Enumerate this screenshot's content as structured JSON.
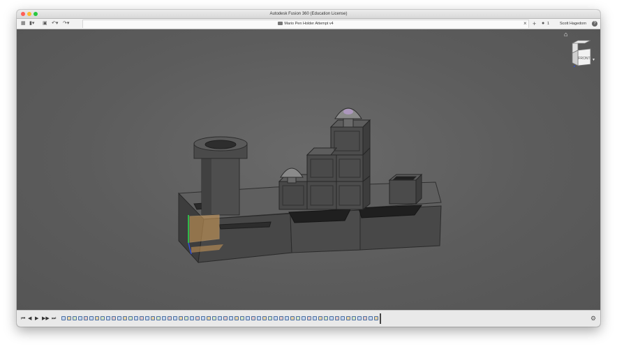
{
  "window": {
    "title": "Autodesk Fusion 360 (Education License)",
    "traffic_lights": {
      "close": "#fe5f57",
      "minimize": "#febc2e",
      "maximize": "#28c840"
    }
  },
  "toolbar": {
    "icons": [
      "grid-icon",
      "file-icon",
      "save-icon",
      "undo-icon",
      "redo-icon"
    ],
    "document_tab": {
      "title": "Mario Pen Holder Attempt v4",
      "close_glyph": "×"
    },
    "new_tab_glyph": "+",
    "job_count": "1",
    "user_name": "Scott Hagedorn",
    "help_glyph": "?"
  },
  "viewcube": {
    "face_label": "FRONT"
  },
  "model": {
    "body_color": "#4a4a4a",
    "highlight_color": "#d9a25a",
    "axis_colors": {
      "x": "#d93030",
      "y": "#2fb84a",
      "z": "#2f4fd9"
    }
  },
  "timeline": {
    "controls": [
      "⏮",
      "◀",
      "▶",
      "▶▶",
      "⏭"
    ],
    "feature_count": 57,
    "feature_colors": [
      "#c9d8ef",
      "#e7d3a8",
      "#d7e6c6",
      "#c9d8ef",
      "#e2c9c9"
    ]
  }
}
